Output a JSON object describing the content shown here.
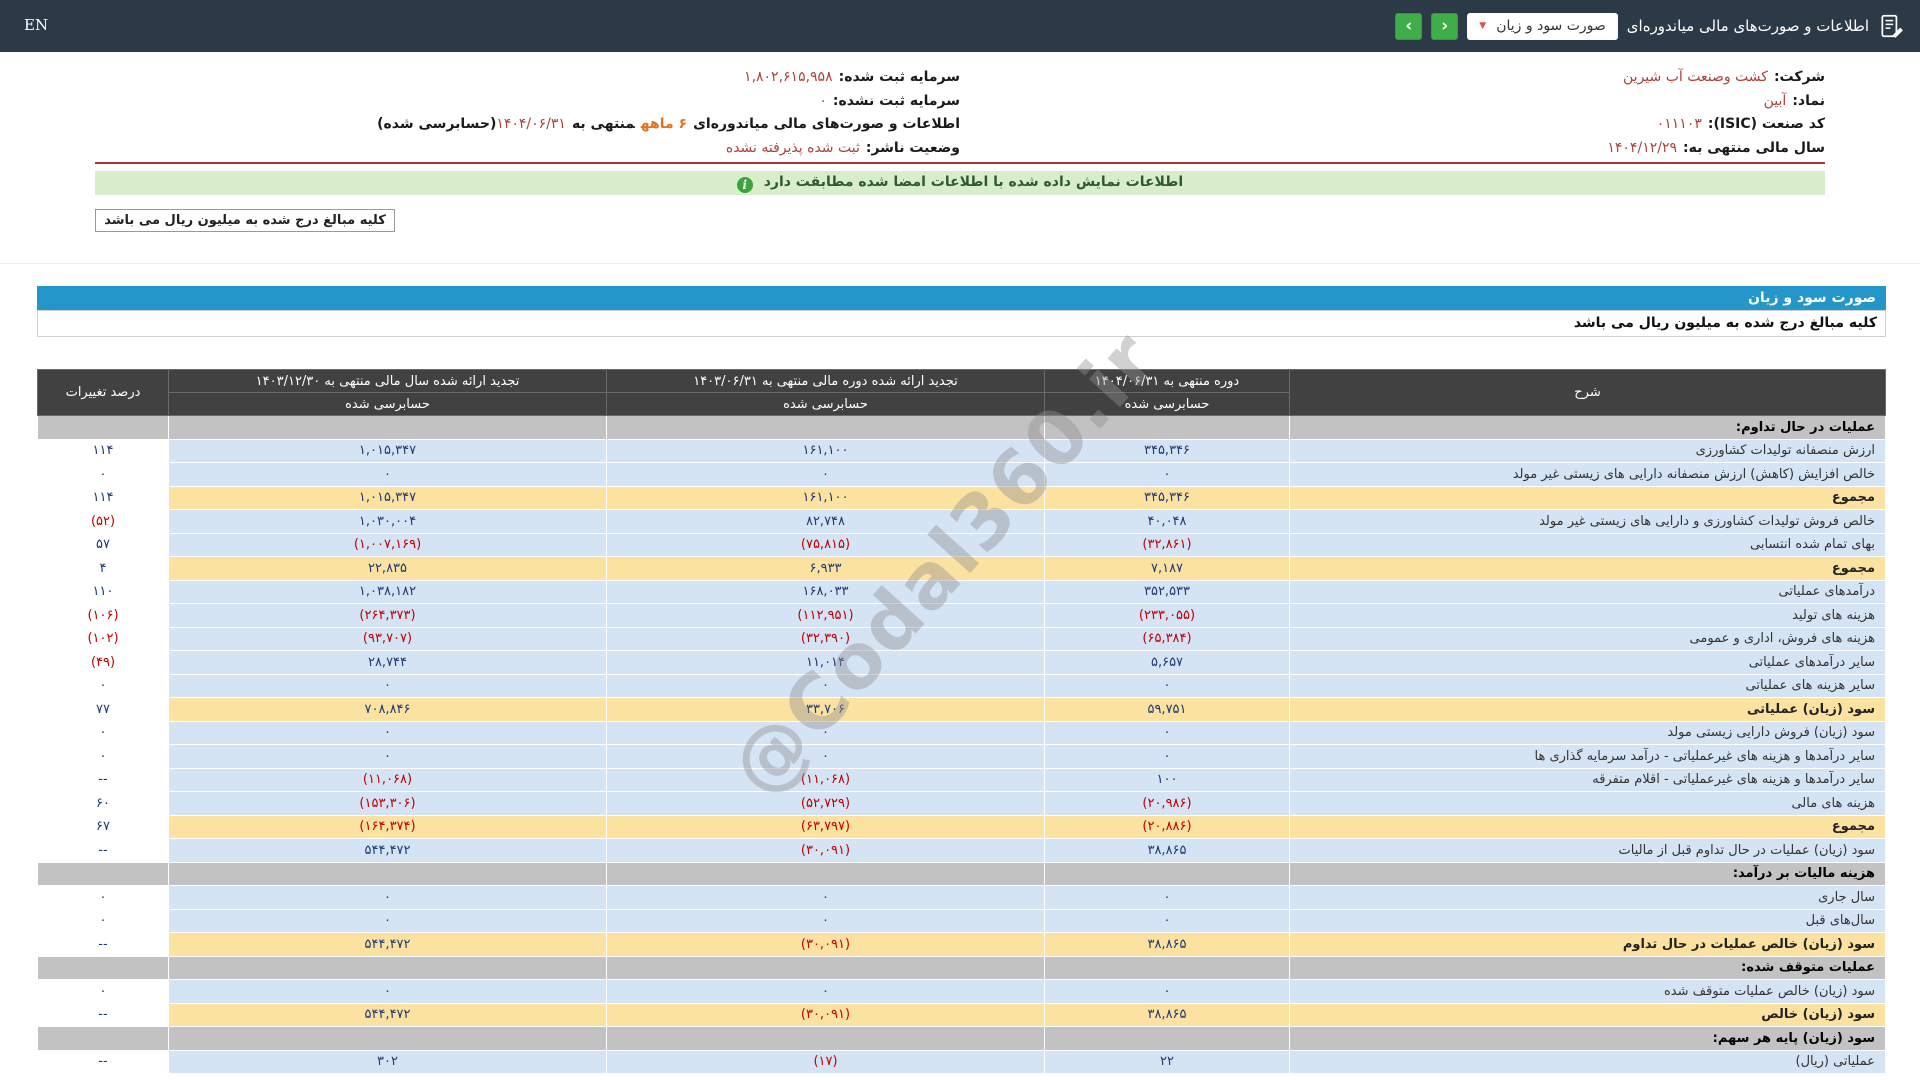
{
  "topbar": {
    "title": "اطلاعات و صورت‌های مالی میاندوره‌ای",
    "dropdown_value": "صورت سود و زیان",
    "en_label": "EN"
  },
  "icons": {
    "caret": "▼",
    "chev_left": "‹",
    "chev_right": "›",
    "info": "i"
  },
  "company": {
    "right": [
      {
        "label": "شرکت:",
        "value": "کشت وصنعت آب شیرین"
      },
      {
        "label": "نماد:",
        "value": "آبین"
      },
      {
        "label": "کد صنعت (ISIC):",
        "value": "۰۱۱۱۰۳"
      },
      {
        "label": "سال مالی منتهی به:",
        "value": "۱۴۰۴/۱۲/۲۹"
      }
    ],
    "left": [
      {
        "label": "سرمایه ثبت شده:",
        "value": "۱,۸۰۲,۶۱۵,۹۵۸"
      },
      {
        "label": "سرمایه ثبت نشده:",
        "value": "۰"
      },
      {
        "label": "وضعیت ناشر:",
        "value": "ثبت شده پذیرفته نشده"
      }
    ],
    "period_line": {
      "prefix": "اطلاعات و صورت‌های مالی میاندوره‌ای",
      "duration": "۶ ماهه",
      "middle": "منتهی به",
      "date": "۱۴۰۴/۰۶/۳۱",
      "suffix": "(حسابرسی شده)"
    }
  },
  "banner": {
    "text": "اطلاعات نمایش داده شده با اطلاعات امضا شده مطابقت دارد"
  },
  "unit_note": "کلیه مبالغ درج شده به میلیون ریال می باشد",
  "statement": {
    "title": "صورت سود و زیان",
    "note": "کلیه مبالغ درج شده به میلیون ریال می باشد"
  },
  "watermark": "@Codal360.ir",
  "table": {
    "col_desc": "شرح",
    "col_current": "دوره منتهی به ۱۴۰۴/۰۶/۳۱",
    "col_restated_period": "تجدید ارائه شده دوره مالی منتهی به ۱۴۰۳/۰۶/۳۱",
    "col_restated_year": "تجدید ارائه شده سال مالی منتهی به ۱۴۰۳/۱۲/۳۰",
    "col_change": "درصد تغییرات",
    "audited": "حسابرسی شده",
    "rows": [
      {
        "type": "section",
        "label": "عملیات در حال تداوم:"
      },
      {
        "type": "data",
        "label": "ارزش منصفانه تولیدات کشاورزی",
        "vals": [
          "۳۴۵,۳۴۶",
          "۱۶۱,۱۰۰",
          "۱,۰۱۵,۳۴۷",
          "۱۱۴"
        ]
      },
      {
        "type": "data",
        "label": "خالص افزایش (کاهش) ارزش منصفانه دارایی های زیستی غیر مولد",
        "vals": [
          "۰",
          "۰",
          "۰",
          "۰"
        ]
      },
      {
        "type": "total",
        "label": "مجموع",
        "vals": [
          "۳۴۵,۳۴۶",
          "۱۶۱,۱۰۰",
          "۱,۰۱۵,۳۴۷",
          "۱۱۴"
        ]
      },
      {
        "type": "data",
        "label": "خالص فروش تولیدات کشاورزی و دارایی های زیستی غیر مولد",
        "vals": [
          "۴۰,۰۴۸",
          "۸۲,۷۴۸",
          "۱,۰۳۰,۰۰۴",
          "(۵۲)"
        ]
      },
      {
        "type": "data",
        "label": "بهای تمام شده انتسابی",
        "vals": [
          "(۳۲,۸۶۱)",
          "(۷۵,۸۱۵)",
          "(۱,۰۰۷,۱۶۹)",
          "۵۷"
        ]
      },
      {
        "type": "total",
        "label": "مجموع",
        "vals": [
          "۷,۱۸۷",
          "۶,۹۳۳",
          "۲۲,۸۳۵",
          "۴"
        ]
      },
      {
        "type": "data",
        "label": "درآمدهای عملیاتی",
        "vals": [
          "۳۵۲,۵۳۳",
          "۱۶۸,۰۳۳",
          "۱,۰۳۸,۱۸۲",
          "۱۱۰"
        ]
      },
      {
        "type": "data",
        "label": "هزینه های تولید",
        "vals": [
          "(۲۳۳,۰۵۵)",
          "(۱۱۲,۹۵۱)",
          "(۲۶۴,۳۷۳)",
          "(۱۰۶)"
        ]
      },
      {
        "type": "data",
        "label": "هزینه های فروش، اداری و عمومی",
        "vals": [
          "(۶۵,۳۸۴)",
          "(۳۲,۳۹۰)",
          "(۹۳,۷۰۷)",
          "(۱۰۲)"
        ]
      },
      {
        "type": "data",
        "label": "سایر درآمدهای عملیاتی",
        "vals": [
          "۵,۶۵۷",
          "۱۱,۰۱۴",
          "۲۸,۷۴۴",
          "(۴۹)"
        ]
      },
      {
        "type": "data",
        "label": "سایر هزینه های عملیاتی",
        "vals": [
          "۰",
          "۰",
          "۰",
          "۰"
        ]
      },
      {
        "type": "total",
        "label": "سود (زیان) عملیاتی",
        "vals": [
          "۵۹,۷۵۱",
          "۳۳,۷۰۶",
          "۷۰۸,۸۴۶",
          "۷۷"
        ]
      },
      {
        "type": "data",
        "label": "سود (زیان) فروش دارایی زیستی مولد",
        "vals": [
          "۰",
          "۰",
          "۰",
          "۰"
        ]
      },
      {
        "type": "data",
        "label": "سایر درآمدها و هزینه های غیرعملیاتی - درآمد سرمایه گذاری ها",
        "vals": [
          "۰",
          "۰",
          "۰",
          "۰"
        ]
      },
      {
        "type": "data",
        "label": "سایر درآمدها و هزینه های غیرعملیاتی - اقلام متفرقه",
        "vals": [
          "۱۰۰",
          "(۱۱,۰۶۸)",
          "(۱۱,۰۶۸)",
          "--"
        ]
      },
      {
        "type": "data",
        "label": "هزینه های مالی",
        "vals": [
          "(۲۰,۹۸۶)",
          "(۵۲,۷۲۹)",
          "(۱۵۳,۳۰۶)",
          "۶۰"
        ]
      },
      {
        "type": "total",
        "label": "مجموع",
        "vals": [
          "(۲۰,۸۸۶)",
          "(۶۳,۷۹۷)",
          "(۱۶۴,۳۷۴)",
          "۶۷"
        ]
      },
      {
        "type": "data",
        "label": "سود (زیان) عملیات در حال تداوم قبل از مالیات",
        "vals": [
          "۳۸,۸۶۵",
          "(۳۰,۰۹۱)",
          "۵۴۴,۴۷۲",
          "--"
        ]
      },
      {
        "type": "section",
        "label": "هزینه مالیات بر درآمد:"
      },
      {
        "type": "data",
        "label": "سال جاری",
        "vals": [
          "۰",
          "۰",
          "۰",
          "۰"
        ]
      },
      {
        "type": "data",
        "label": "سال‌های قبل",
        "vals": [
          "۰",
          "۰",
          "۰",
          "۰"
        ]
      },
      {
        "type": "total",
        "label": "سود (زیان) خالص عملیات در حال تداوم",
        "vals": [
          "۳۸,۸۶۵",
          "(۳۰,۰۹۱)",
          "۵۴۴,۴۷۲",
          "--"
        ]
      },
      {
        "type": "section",
        "label": "عملیات متوقف شده:"
      },
      {
        "type": "data",
        "label": "سود (زیان) خالص عملیات متوقف شده",
        "vals": [
          "۰",
          "۰",
          "۰",
          "۰"
        ]
      },
      {
        "type": "total",
        "label": "سود (زیان) خالص",
        "vals": [
          "۳۸,۸۶۵",
          "(۳۰,۰۹۱)",
          "۵۴۴,۴۷۲",
          "--"
        ]
      },
      {
        "type": "section",
        "label": "سود (زیان) پایه هر سهم:"
      },
      {
        "type": "data",
        "label": "عملیاتی (ریال)",
        "vals": [
          "۲۲",
          "(۱۷)",
          "۳۰۲",
          "--"
        ]
      }
    ]
  }
}
